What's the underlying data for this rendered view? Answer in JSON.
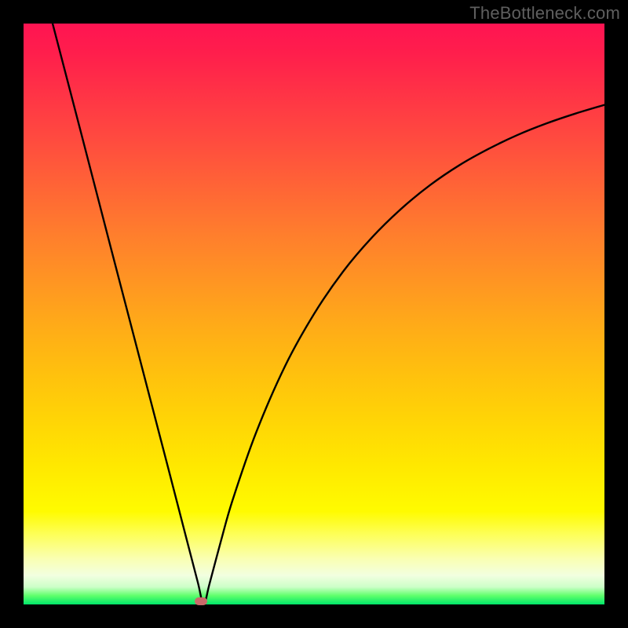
{
  "watermark": "TheBottleneck.com",
  "chart_data": {
    "type": "line",
    "title": "",
    "xlabel": "",
    "ylabel": "",
    "xlim": [
      0,
      100
    ],
    "ylim": [
      0,
      100
    ],
    "grid": false,
    "legend": false,
    "annotations": [],
    "marker": {
      "x": 30.5,
      "y": 0.5,
      "color": "#c96a6a"
    },
    "series": [
      {
        "name": "bottleneck-curve",
        "color": "#000000",
        "x": [
          5,
          10,
          15,
          20,
          25,
          28,
          30,
          31,
          32,
          34,
          36,
          40,
          45,
          50,
          55,
          60,
          65,
          70,
          75,
          80,
          85,
          90,
          95,
          100
        ],
        "y": [
          100,
          80.8,
          61.5,
          42.3,
          23.1,
          11.5,
          3.8,
          0.0,
          3.5,
          11.0,
          18.0,
          29.5,
          41.0,
          50.0,
          57.3,
          63.2,
          68.1,
          72.2,
          75.6,
          78.4,
          80.8,
          82.8,
          84.5,
          86.0
        ]
      }
    ],
    "background_gradient": {
      "top": "#ff1452",
      "mid1": "#ffab18",
      "mid2": "#fffb00",
      "bottom": "#00e66a"
    }
  }
}
